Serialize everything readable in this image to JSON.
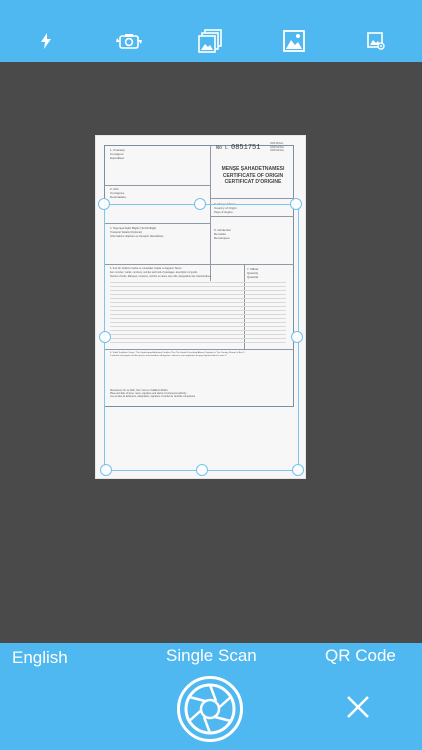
{
  "toolbar": {
    "items": [
      {
        "name": "flash-icon"
      },
      {
        "name": "rotate-camera-icon"
      },
      {
        "name": "multi-image-icon"
      },
      {
        "name": "gallery-icon"
      },
      {
        "name": "image-settings-icon"
      }
    ]
  },
  "document": {
    "cert_prefix": "No L",
    "cert_number": "0851751",
    "original_label": "ORIJINAL\nORIGINAL\nORIGINAL",
    "title_line1": "MENŞE ŞAHADETNAMESI",
    "title_line2": "CERTIFICATE OF ORIGIN",
    "title_line3": "CERTIFICAT D'ORIGINE",
    "field_1": "1. Ihracatçi\nConsignor\nExpéditeur",
    "field_2": "2. Alici\nConsignee\nDestinataire",
    "field_3": "3. Menşe Ülkesi\nCountry of Origin\nPays d'origine",
    "field_4": "4. Taşımaya İlişkin Bilgiler (Tercihi Bağlı)\nTransport Details (Optional)\nInformations relatives au transport (facultative)",
    "field_5": "5. Gözlemler\nRemarks\nRemarques",
    "field_6": "6. Sıra No; Kolilerin marka ve numaraları; Kaplar ve Eşyanın Tanımı\nItem number; marks, numbers, number and kind of packages, description of goods\nNuméro d'ordre; Marques, numéros, nombre et nature des colis, désignation des marchandises",
    "field_7": "7. Miktar\nQuantity\nQuantité",
    "field_8": "8. Yetkili Teşkilatın Onayı / The Undersigned Authority Certifies That The Goods Described Above Originate In The Country Shown In Box 3\nL'autorité soussignée certifie que les marchandises désignées ci-dessus sont originaires du pays figurant dans la case 3",
    "field_9": "Düzenlenen Yer ve Tarih, İsim, İmza ve Yetkililerin Mührü\nPlace and date of issue, name, signature and stamp of competent authority\nLieu et date de délivrance, désignation, signature et cachet de l'autorité compétente"
  },
  "bottom": {
    "language_label": "English",
    "mode_label": "Single Scan",
    "qr_label": "QR Code",
    "shutter": "shutter-icon",
    "close": "close-icon"
  },
  "colors": {
    "bar": "#4fb8f0",
    "viewport": "#4a4a4a",
    "handle": "#74c0ec"
  }
}
